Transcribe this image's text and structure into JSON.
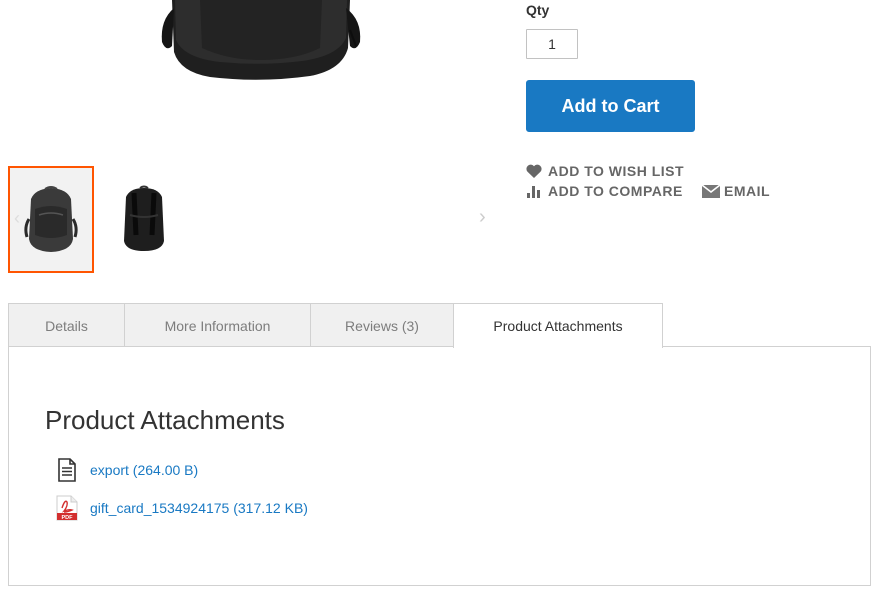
{
  "product": {
    "qty_label": "Qty",
    "qty_value": "1",
    "add_to_cart_label": "Add to Cart",
    "wishlist_label": "ADD TO WISH LIST",
    "compare_label": "ADD TO COMPARE",
    "email_label": "EMAIL"
  },
  "gallery": {
    "thumbnails": [
      "backpack-front",
      "backpack-back"
    ],
    "active_index": 0
  },
  "tabs": [
    {
      "label": "Details",
      "active": false
    },
    {
      "label": "More Information",
      "active": false
    },
    {
      "label": "Reviews (3)",
      "active": false
    },
    {
      "label": "Product Attachments",
      "active": true
    }
  ],
  "attachments": {
    "title": "Product Attachments",
    "items": [
      {
        "label": "export (264.00 B)",
        "icon": "document-icon"
      },
      {
        "label": "gift_card_1534924175 (317.12 KB)",
        "icon": "pdf-icon"
      }
    ]
  },
  "colors": {
    "accent": "#1979c3",
    "active_thumb_border": "#ff5501",
    "pdf_red": "#e53935"
  }
}
